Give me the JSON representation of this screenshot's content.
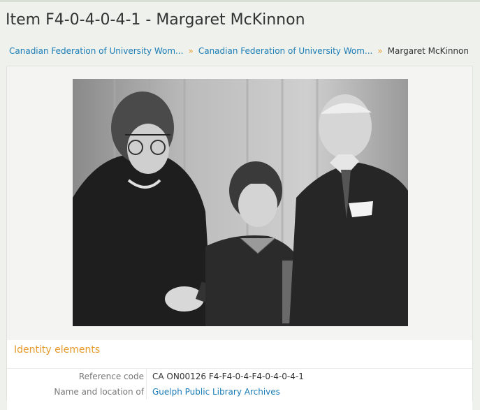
{
  "page": {
    "title": "Item F4-0-4-0-4-1 - Margaret McKinnon"
  },
  "breadcrumb": {
    "items": [
      {
        "label": "Canadian Federation of University Wom..."
      },
      {
        "label": "Canadian Federation of University Wom..."
      },
      {
        "label": "Margaret McKinnon"
      }
    ],
    "separator": "»"
  },
  "digital_object": {
    "alt": "Black and white photograph of a woman, a girl and an elderly man"
  },
  "identity_section": {
    "title": "Identity elements",
    "fields": [
      {
        "label": "Reference code",
        "value": "CA ON00126 F4-F4-0-4-F4-0-4-0-4-1"
      },
      {
        "label": "Name and location of",
        "value": "Guelph Public Library Archives"
      }
    ]
  },
  "colors": {
    "link": "#1a7cb6",
    "section_title": "#e59b2e",
    "breadcrumb_separator": "#e8a33a"
  }
}
